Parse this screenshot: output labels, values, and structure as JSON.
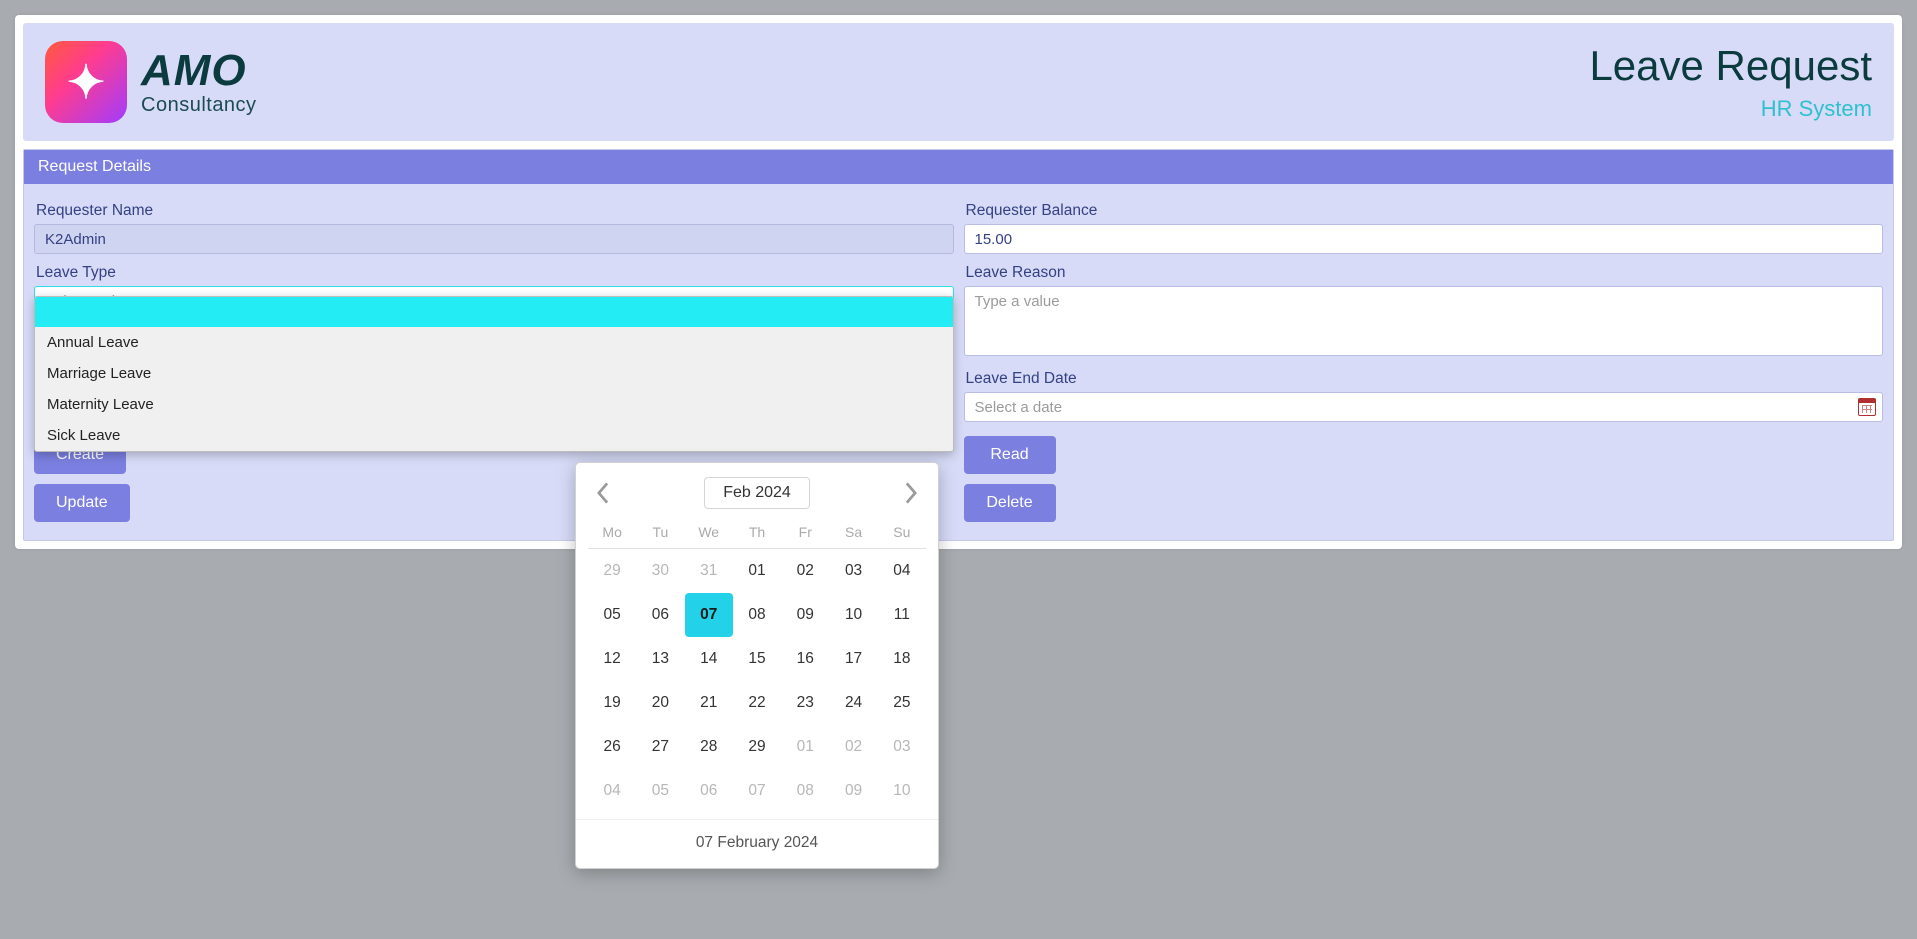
{
  "header": {
    "logo_main": "AMO",
    "logo_sub": "Consultancy",
    "title": "Leave Request",
    "subtitle": "HR System"
  },
  "section": {
    "title": "Request Details",
    "labels": {
      "requester_name": "Requester Name",
      "requester_balance": "Requester Balance",
      "leave_type": "Leave Type",
      "leave_reason": "Leave Reason",
      "leave_end_date": "Leave End Date"
    },
    "values": {
      "requester_name": "K2Admin",
      "requester_balance": "15.00"
    },
    "placeholders": {
      "leave_type": "Select an item",
      "leave_reason": "Type a value",
      "leave_end_date": "Select a date"
    }
  },
  "dropdown": {
    "items": [
      "Annual Leave",
      "Marriage Leave",
      "Maternity Leave",
      "Sick Leave"
    ]
  },
  "buttons": {
    "create": "Create",
    "update": "Update",
    "read": "Read",
    "delete": "Delete"
  },
  "calendar": {
    "title": "Feb 2024",
    "weekdays": [
      "Mo",
      "Tu",
      "We",
      "Th",
      "Fr",
      "Sa",
      "Su"
    ],
    "footer": "07 February 2024",
    "selected": "07",
    "weeks": [
      [
        {
          "d": "29",
          "m": true
        },
        {
          "d": "30",
          "m": true
        },
        {
          "d": "31",
          "m": true
        },
        {
          "d": "01"
        },
        {
          "d": "02"
        },
        {
          "d": "03"
        },
        {
          "d": "04"
        }
      ],
      [
        {
          "d": "05"
        },
        {
          "d": "06"
        },
        {
          "d": "07",
          "sel": true
        },
        {
          "d": "08"
        },
        {
          "d": "09"
        },
        {
          "d": "10"
        },
        {
          "d": "11"
        }
      ],
      [
        {
          "d": "12"
        },
        {
          "d": "13"
        },
        {
          "d": "14"
        },
        {
          "d": "15"
        },
        {
          "d": "16"
        },
        {
          "d": "17"
        },
        {
          "d": "18"
        }
      ],
      [
        {
          "d": "19"
        },
        {
          "d": "20"
        },
        {
          "d": "21"
        },
        {
          "d": "22"
        },
        {
          "d": "23"
        },
        {
          "d": "24"
        },
        {
          "d": "25"
        }
      ],
      [
        {
          "d": "26"
        },
        {
          "d": "27"
        },
        {
          "d": "28"
        },
        {
          "d": "29"
        },
        {
          "d": "01",
          "m": true
        },
        {
          "d": "02",
          "m": true
        },
        {
          "d": "03",
          "m": true
        }
      ],
      [
        {
          "d": "04",
          "m": true
        },
        {
          "d": "05",
          "m": true
        },
        {
          "d": "06",
          "m": true
        },
        {
          "d": "07",
          "m": true
        },
        {
          "d": "08",
          "m": true
        },
        {
          "d": "09",
          "m": true
        },
        {
          "d": "10",
          "m": true
        }
      ]
    ]
  }
}
